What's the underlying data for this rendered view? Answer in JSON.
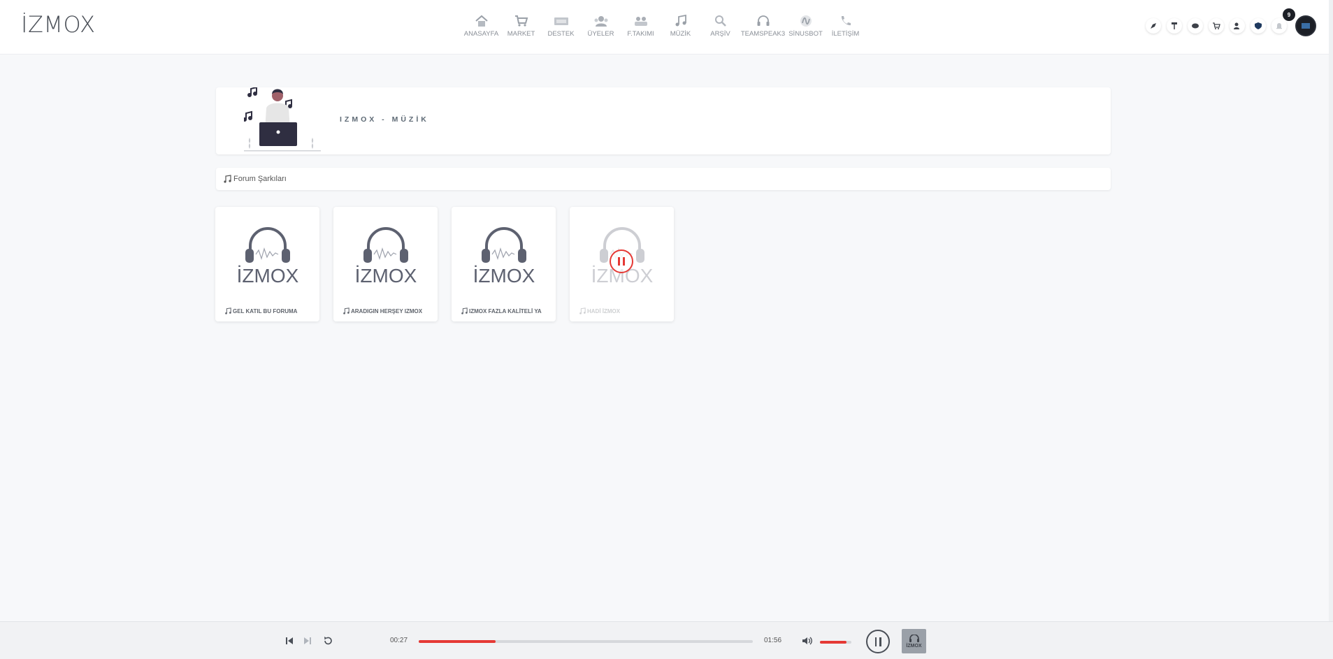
{
  "brand": {
    "logo": "İZMOX"
  },
  "nav": {
    "items": [
      {
        "label": "ANASAYFA",
        "icon": "home-icon"
      },
      {
        "label": "MARKET",
        "icon": "cart-icon"
      },
      {
        "label": "DESTEK",
        "icon": "ticket-icon"
      },
      {
        "label": "ÜYELER",
        "icon": "users-icon"
      },
      {
        "label": "F.TAKIMI",
        "icon": "team-icon"
      },
      {
        "label": "MÜZİK",
        "icon": "music-icon"
      },
      {
        "label": "ARŞİV",
        "icon": "search-icon"
      },
      {
        "label": "TEAMSPEAK3",
        "icon": "headset-icon"
      },
      {
        "label": "SİNUSBOT",
        "icon": "sinusbot-icon"
      },
      {
        "label": "İLETİŞİM",
        "icon": "phone-icon"
      }
    ]
  },
  "header": {
    "notification_count": "9"
  },
  "banner": {
    "title": "IZMOX - MÜZİK"
  },
  "section": {
    "title": "Forum Şarkıları"
  },
  "songs": [
    {
      "title": "GEL KATIL BU FORUMA",
      "playing": false
    },
    {
      "title": "ARADIGIN HERŞEY IZMOX",
      "playing": false
    },
    {
      "title": "IZMOX FAZLA KALİTELİ YA",
      "playing": false
    },
    {
      "title": "HADİ İZMOX",
      "playing": true
    }
  ],
  "card_art_text": "İZMOX",
  "player": {
    "current_time": "00:27",
    "duration": "01:56",
    "progress_fraction": 0.23,
    "volume_fraction": 0.85,
    "thumb_label": "İZMOX",
    "accent": "#e53935"
  }
}
